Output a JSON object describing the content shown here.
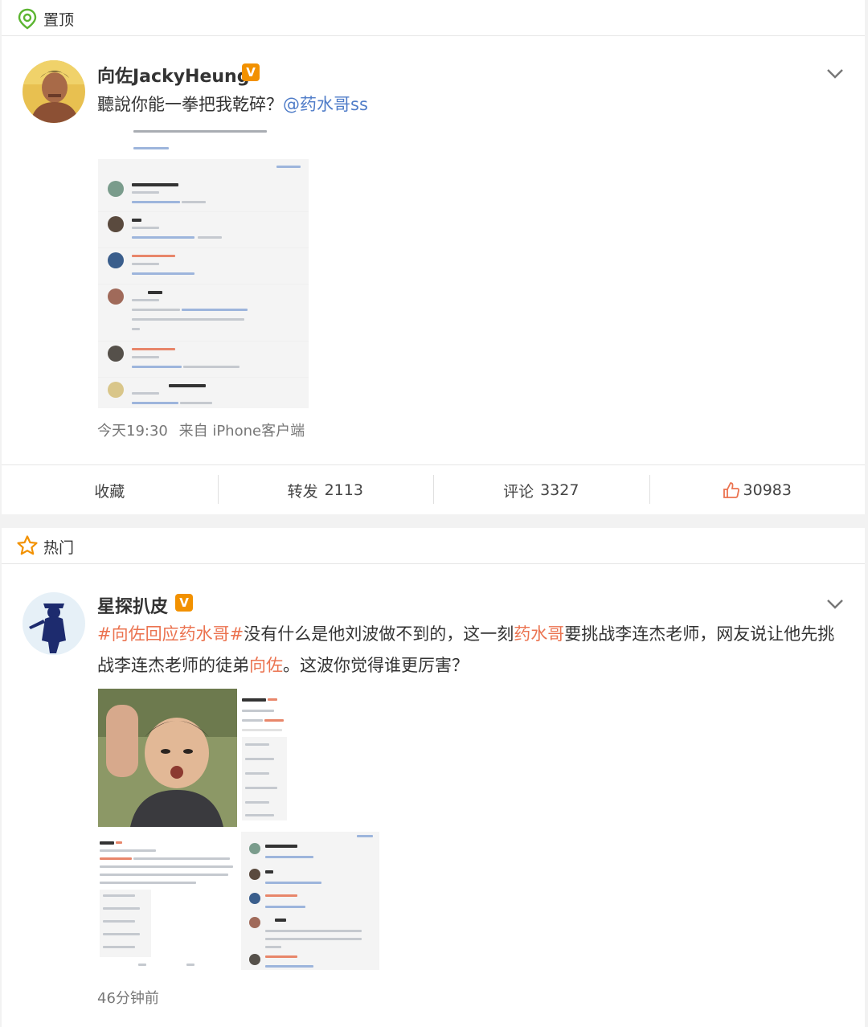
{
  "pinned_section": {
    "label": "置顶",
    "icon": "pin-location-icon"
  },
  "post1": {
    "author": "向佐JackyHeung",
    "verified_mark": "V",
    "text_prefix": "聽說你能一拳把我乾碎？",
    "mention": "@药水哥ss",
    "timestamp": "今天19:30",
    "source": "来自 iPhone客户端",
    "actions": {
      "favorite_label": "收藏",
      "repost_label": "转发",
      "repost_count": "2113",
      "comment_label": "评论",
      "comment_count": "3327",
      "like_count": "30983"
    }
  },
  "hot_section": {
    "label": "热门",
    "icon": "star-icon"
  },
  "post2": {
    "author": "星探扒皮",
    "verified_mark": "V",
    "hashtag": "#向佐回应药水哥#",
    "text_1": "没有什么是他刘波做不到的，这一刻",
    "link_1": "药水哥",
    "text_2": "要挑战李连杰老师，网友说让他先挑战李连杰老师的徒弟",
    "link_2": "向佐",
    "text_3": "。这波你觉得谁更厉害？",
    "timestamp": "46分钟前"
  },
  "colors": {
    "link": "#eb7350",
    "mention": "#4f7cc8",
    "badge": "#f29100",
    "pin": "#5cb531"
  }
}
